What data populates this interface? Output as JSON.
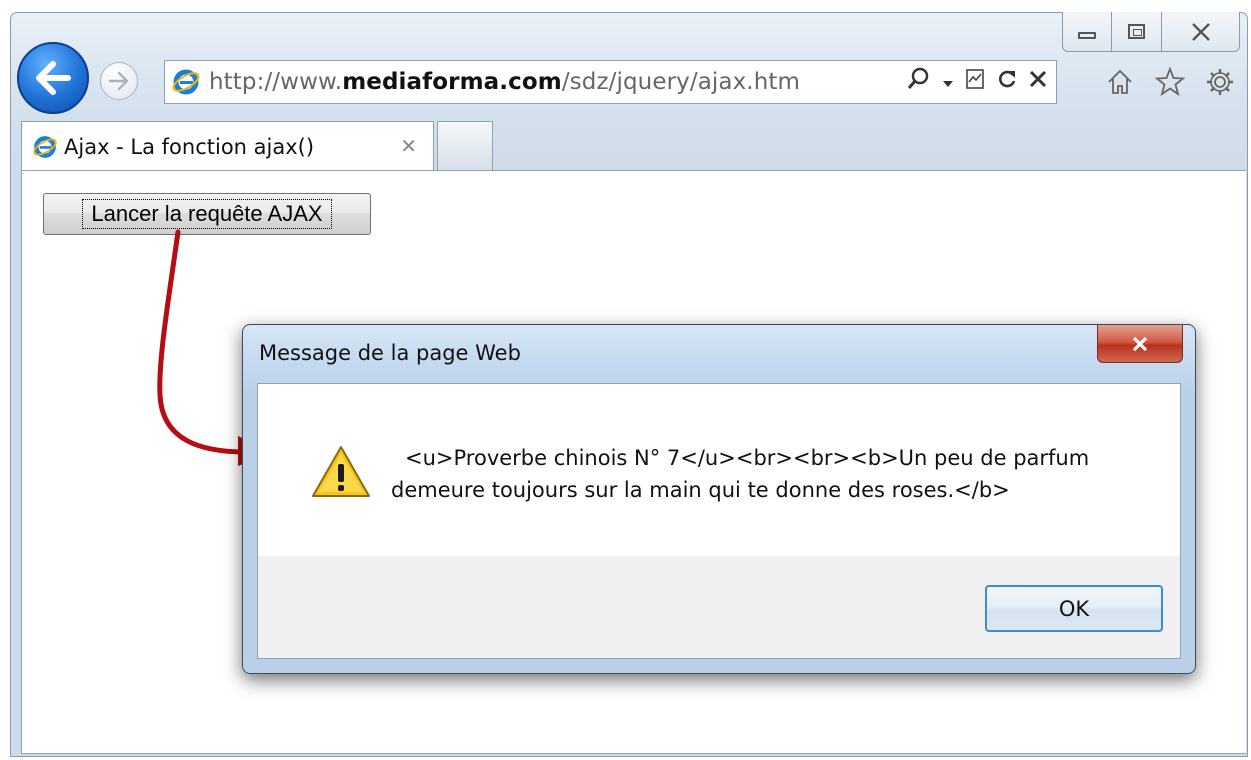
{
  "browser": {
    "address_bar": {
      "url_prefix": "http://www.",
      "url_domain": "mediaforma.com",
      "url_path": "/sdz/jquery/ajax.htm"
    },
    "tab": {
      "title": "Ajax - La fonction ajax()",
      "close_glyph": "✕"
    }
  },
  "page": {
    "ajax_button_label": "Lancer la requête AJAX"
  },
  "dialog": {
    "title": "Message de la page Web",
    "close_glyph": "x",
    "message_line1": "<u>Proverbe chinois N° 7</u><br><br><b>Un peu de parfum",
    "message_line2": "demeure toujours sur la main qui te donne des roses.</b>",
    "ok_label": "OK"
  },
  "colors": {
    "arrow": "#b40d12",
    "dialog_close": "#c8412b",
    "ok_border": "#3c8ad8"
  },
  "icons": [
    "back-arrow-icon",
    "forward-arrow-icon",
    "ie-logo-icon",
    "search-icon",
    "compat-view-icon",
    "refresh-icon",
    "stop-icon",
    "home-icon",
    "favorites-star-icon",
    "gear-icon",
    "warning-icon"
  ]
}
